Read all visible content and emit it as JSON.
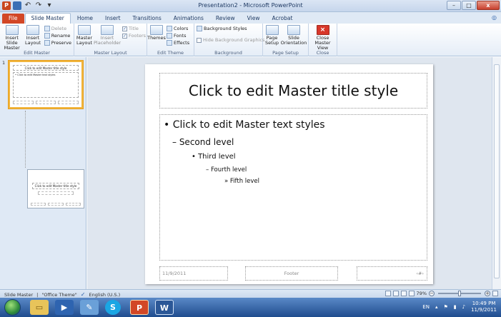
{
  "window": {
    "title": "Presentation2 - Microsoft PowerPoint",
    "app_icon_letter": "P",
    "minimize": "–",
    "maximize": "□",
    "close": "x"
  },
  "tabs": [
    "File",
    "Slide Master",
    "Home",
    "Insert",
    "Transitions",
    "Animations",
    "Review",
    "View",
    "Acrobat"
  ],
  "ribbon": {
    "edit_master": {
      "label": "Edit Master",
      "insert_slide_master": "Insert Slide Master",
      "insert_layout": "Insert Layout",
      "delete": "Delete",
      "rename": "Rename",
      "preserve": "Preserve"
    },
    "master_layout": {
      "label": "Master Layout",
      "master_layout_btn": "Master Layout",
      "insert_placeholder": "Insert Placeholder",
      "title": "Title",
      "footers": "Footers"
    },
    "edit_theme": {
      "label": "Edit Theme",
      "themes": "Themes",
      "colors": "Colors",
      "fonts": "Fonts",
      "effects": "Effects"
    },
    "background": {
      "label": "Background",
      "background_styles": "Background Styles",
      "hide_background_graphics": "Hide Background Graphics"
    },
    "page_setup": {
      "label": "Page Setup",
      "page_setup_btn": "Page Setup",
      "slide_orientation": "Slide Orientation"
    },
    "close": {
      "label": "Close",
      "close_master_view": "Close Master View"
    }
  },
  "thumbnails": {
    "number": "1",
    "master_title": "Click to edit Master title style",
    "master_body": "• Click to edit Master text styles",
    "layout_title": "Click to edit Master title style"
  },
  "slide": {
    "title": "Click to edit Master title style",
    "levels": [
      "• Click to edit Master text styles",
      "– Second level",
      "• Third level",
      "– Fourth level",
      "» Fifth level"
    ],
    "footer_date": "11/9/2011",
    "footer_text": "Footer",
    "footer_number": "‹#›"
  },
  "status": {
    "view": "Slide Master",
    "theme": "\"Office Theme\"",
    "language": "English (U.S.)",
    "zoom": "79%"
  },
  "taskbar": {
    "language": "EN",
    "time": "10:49 PM",
    "date": "11/9/2011",
    "ppt_letter": "P",
    "word_letter": "W",
    "skype_letter": "S"
  }
}
